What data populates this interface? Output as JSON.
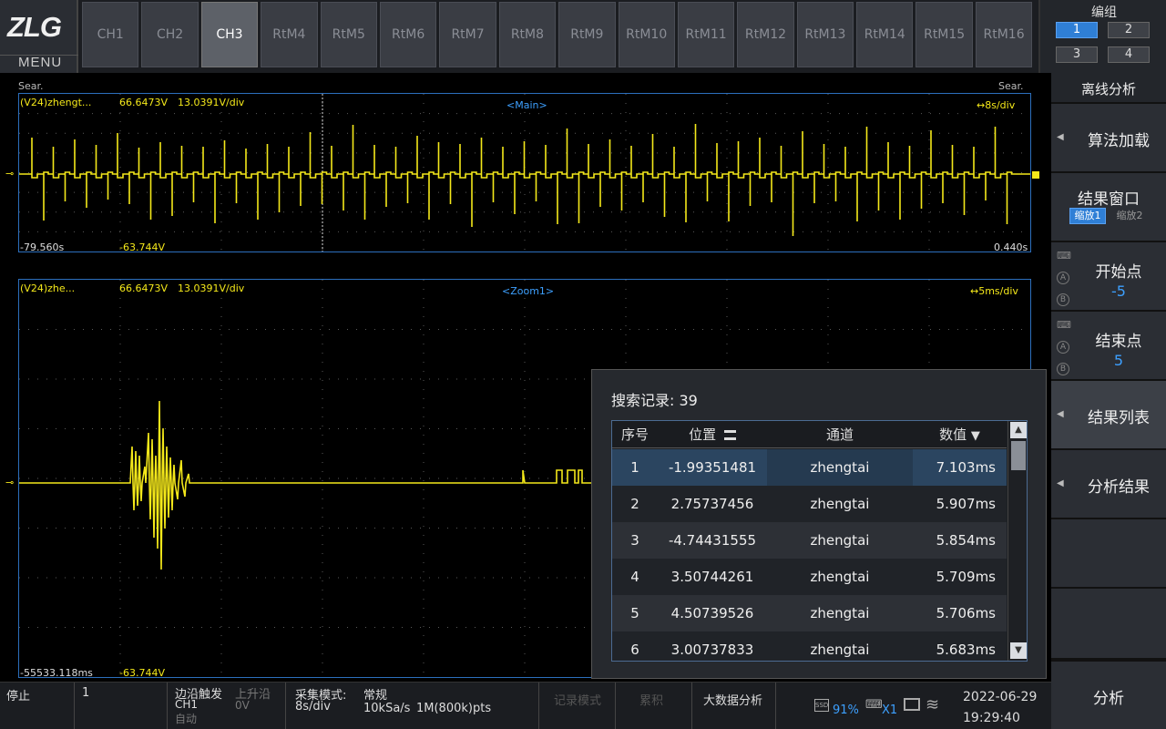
{
  "logo": {
    "brand": "ZLG",
    "menu": "MENU"
  },
  "tabs": [
    "CH1",
    "CH2",
    "CH3",
    "RtM4",
    "RtM5",
    "RtM6",
    "RtM7",
    "RtM8",
    "RtM9",
    "RtM10",
    "RtM11",
    "RtM12",
    "RtM13",
    "RtM14",
    "RtM15",
    "RtM16"
  ],
  "active_tab": "CH3",
  "group": {
    "title": "编组",
    "buttons": [
      "1",
      "2",
      "3",
      "4"
    ],
    "active": "1"
  },
  "right_panel": {
    "title": "离线分析",
    "algorithm_load": "算法加载",
    "result_window": "结果窗口",
    "zoom1": "缩放1",
    "zoom2": "缩放2",
    "start_point": {
      "label": "开始点",
      "value": "-5"
    },
    "end_point": {
      "label": "结束点",
      "value": "5"
    },
    "result_list": "结果列表",
    "analysis_result": "分析结果",
    "analyze": "分析",
    "icon_a": "A",
    "icon_b": "B"
  },
  "main_scope": {
    "search_left": "Sear.",
    "search_right": "Sear.",
    "channel": "(V24)zhengt...",
    "voltage": "66.6473V",
    "scale": "13.0391V/div",
    "window": "<Main>",
    "timebase": "↔8s/div",
    "time_left": "-79.560s",
    "offset_voltage": "-63.744V",
    "time_right": "0.440s"
  },
  "zoom_scope": {
    "channel": "(V24)zhe...",
    "voltage": "66.6473V",
    "scale": "13.0391V/div",
    "window": "<Zoom1>",
    "timebase": "↔5ms/div",
    "time_left": "-55533.118ms",
    "offset_voltage": "-63.744V"
  },
  "results": {
    "title": "搜索记录: 39",
    "headers": {
      "index": "序号",
      "position": "位置",
      "channel": "通道",
      "value": "数值"
    },
    "rows": [
      {
        "index": "1",
        "position": "-1.99351481",
        "channel": "zhengtai",
        "value": "7.103ms"
      },
      {
        "index": "2",
        "position": "2.75737456",
        "channel": "zhengtai",
        "value": "5.907ms"
      },
      {
        "index": "3",
        "position": "-4.74431555",
        "channel": "zhengtai",
        "value": "5.854ms"
      },
      {
        "index": "4",
        "position": "3.50744261",
        "channel": "zhengtai",
        "value": "5.709ms"
      },
      {
        "index": "5",
        "position": "4.50739526",
        "channel": "zhengtai",
        "value": "5.706ms"
      },
      {
        "index": "6",
        "position": "3.00737833",
        "channel": "zhengtai",
        "value": "5.683ms"
      }
    ],
    "selected_row": "1"
  },
  "status_bar": {
    "state": "停止",
    "count": "1",
    "trigger_type": "边沿触发",
    "trigger_source": "CH1",
    "trigger_mode": "自动",
    "trigger_edge": "上升沿",
    "trigger_level": "0V",
    "acq_mode_label": "采集模式:",
    "acq_mode": "常规",
    "timebase": "8s/div",
    "sample_rate": "10kSa/s",
    "points": "1M(800k)pts",
    "record_mode": "记录模式",
    "accumulate": "累积",
    "big_data": "大数据分析",
    "ssd_usage": "91%",
    "usb_level": "X1",
    "date": "2022-06-29",
    "time": "19:29:40"
  },
  "colors": {
    "waveform": "#f4e81a",
    "accent": "#3da0ff",
    "grid": "#5a5a5a"
  }
}
